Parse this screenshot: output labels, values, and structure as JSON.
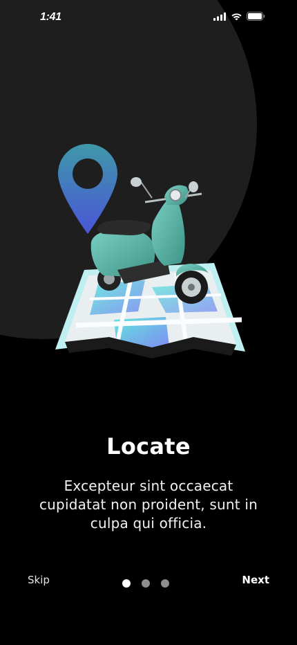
{
  "status_bar": {
    "time": "1:41",
    "icons": [
      "cellular-signal-icon",
      "wifi-icon",
      "battery-icon"
    ]
  },
  "illustration": {
    "icons": [
      "location-pin-icon",
      "scooter-icon",
      "map-icon"
    ],
    "pin_gradient": [
      "#3f98a8",
      "#4a55d8"
    ],
    "map_colors": {
      "road": "#f1f4f6",
      "water": "#5fd9e0",
      "border": "#bfeff0"
    },
    "scooter_color": "#5fb7a8"
  },
  "onboarding": {
    "title": "Locate",
    "description": "Excepteur sint occaecat cupidatat non proident, sunt in culpa qui officia.",
    "skip_label": "Skip",
    "next_label": "Next",
    "page_count": 3,
    "current_page": 1
  },
  "colors": {
    "background": "#000000",
    "circle": "#1e1e1e",
    "dot_active": "#ffffff",
    "dot_inactive": "#8e8e8e"
  }
}
